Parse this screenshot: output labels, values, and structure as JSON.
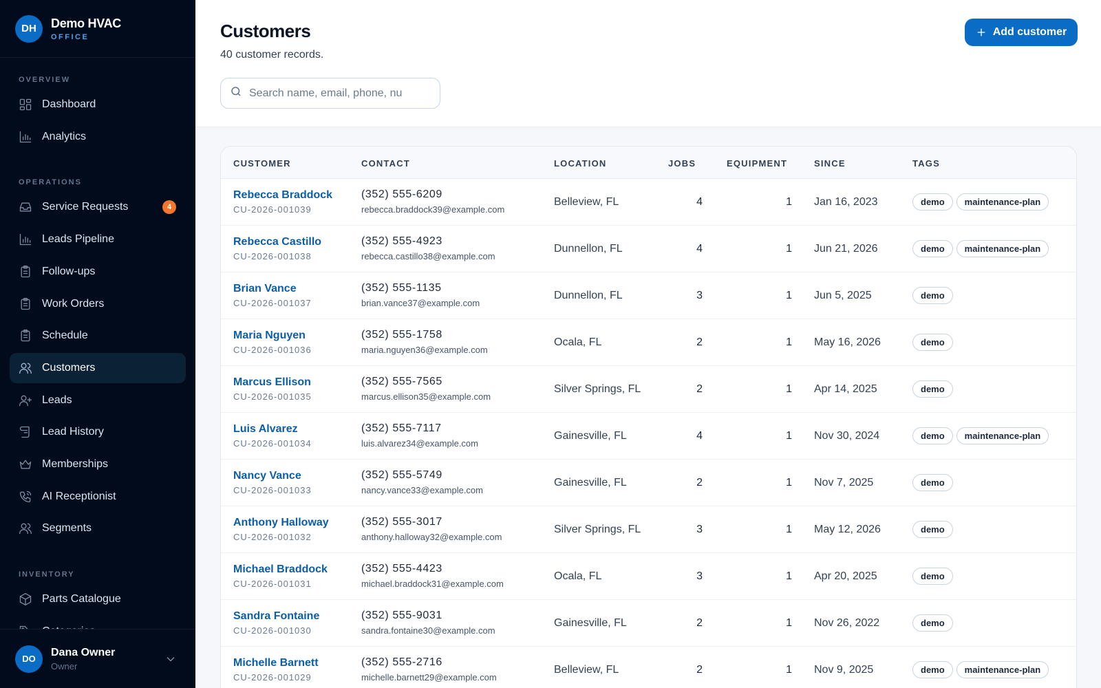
{
  "brand": {
    "initials": "DH",
    "name": "Demo HVAC",
    "sub": "OFFICE"
  },
  "sidebar": {
    "sections": [
      {
        "title": "OVERVIEW",
        "items": [
          {
            "label": "Dashboard",
            "icon": "dashboard-icon"
          },
          {
            "label": "Analytics",
            "icon": "analytics-icon"
          }
        ]
      },
      {
        "title": "OPERATIONS",
        "items": [
          {
            "label": "Service Requests",
            "icon": "inbox-icon",
            "badge": "4"
          },
          {
            "label": "Leads Pipeline",
            "icon": "analytics-icon"
          },
          {
            "label": "Follow-ups",
            "icon": "clipboard-icon"
          },
          {
            "label": "Work Orders",
            "icon": "clipboard-icon"
          },
          {
            "label": "Schedule",
            "icon": "clipboard-icon"
          },
          {
            "label": "Customers",
            "icon": "users-icon",
            "active": true
          },
          {
            "label": "Leads",
            "icon": "user-plus-icon"
          },
          {
            "label": "Lead History",
            "icon": "scroll-icon"
          },
          {
            "label": "Memberships",
            "icon": "crown-icon"
          },
          {
            "label": "AI Receptionist",
            "icon": "phone-icon"
          },
          {
            "label": "Segments",
            "icon": "users-icon"
          }
        ]
      },
      {
        "title": "INVENTORY",
        "items": [
          {
            "label": "Parts Catalogue",
            "icon": "package-icon"
          },
          {
            "label": "Categories",
            "icon": "tag-icon"
          }
        ]
      }
    ]
  },
  "user": {
    "initials": "DO",
    "name": "Dana Owner",
    "role": "Owner"
  },
  "header": {
    "title": "Customers",
    "subtitle": "40 customer records.",
    "search_placeholder": "Search name, email, phone, number",
    "add_label": "Add customer"
  },
  "table": {
    "columns": [
      "CUSTOMER",
      "CONTACT",
      "LOCATION",
      "JOBS",
      "EQUIPMENT",
      "SINCE",
      "TAGS"
    ],
    "rows": [
      {
        "name": "Rebecca Braddock",
        "id": "CU-2026-001039",
        "phone": "(352) 555-6209",
        "email": "rebecca.braddock39@example.com",
        "location": "Belleview, FL",
        "jobs": "4",
        "equipment": "1",
        "since": "Jan 16, 2023",
        "tags": [
          "demo",
          "maintenance-plan"
        ]
      },
      {
        "name": "Rebecca Castillo",
        "id": "CU-2026-001038",
        "phone": "(352) 555-4923",
        "email": "rebecca.castillo38@example.com",
        "location": "Dunnellon, FL",
        "jobs": "4",
        "equipment": "1",
        "since": "Jun 21, 2026",
        "tags": [
          "demo",
          "maintenance-plan"
        ]
      },
      {
        "name": "Brian Vance",
        "id": "CU-2026-001037",
        "phone": "(352) 555-1135",
        "email": "brian.vance37@example.com",
        "location": "Dunnellon, FL",
        "jobs": "3",
        "equipment": "1",
        "since": "Jun 5, 2025",
        "tags": [
          "demo"
        ]
      },
      {
        "name": "Maria Nguyen",
        "id": "CU-2026-001036",
        "phone": "(352) 555-1758",
        "email": "maria.nguyen36@example.com",
        "location": "Ocala, FL",
        "jobs": "2",
        "equipment": "1",
        "since": "May 16, 2026",
        "tags": [
          "demo"
        ]
      },
      {
        "name": "Marcus Ellison",
        "id": "CU-2026-001035",
        "phone": "(352) 555-7565",
        "email": "marcus.ellison35@example.com",
        "location": "Silver Springs, FL",
        "jobs": "2",
        "equipment": "1",
        "since": "Apr 14, 2025",
        "tags": [
          "demo"
        ]
      },
      {
        "name": "Luis Alvarez",
        "id": "CU-2026-001034",
        "phone": "(352) 555-7117",
        "email": "luis.alvarez34@example.com",
        "location": "Gainesville, FL",
        "jobs": "4",
        "equipment": "1",
        "since": "Nov 30, 2024",
        "tags": [
          "demo",
          "maintenance-plan"
        ]
      },
      {
        "name": "Nancy Vance",
        "id": "CU-2026-001033",
        "phone": "(352) 555-5749",
        "email": "nancy.vance33@example.com",
        "location": "Gainesville, FL",
        "jobs": "2",
        "equipment": "1",
        "since": "Nov 7, 2025",
        "tags": [
          "demo"
        ]
      },
      {
        "name": "Anthony Halloway",
        "id": "CU-2026-001032",
        "phone": "(352) 555-3017",
        "email": "anthony.halloway32@example.com",
        "location": "Silver Springs, FL",
        "jobs": "3",
        "equipment": "1",
        "since": "May 12, 2026",
        "tags": [
          "demo"
        ]
      },
      {
        "name": "Michael Braddock",
        "id": "CU-2026-001031",
        "phone": "(352) 555-4423",
        "email": "michael.braddock31@example.com",
        "location": "Ocala, FL",
        "jobs": "3",
        "equipment": "1",
        "since": "Apr 20, 2025",
        "tags": [
          "demo"
        ]
      },
      {
        "name": "Sandra Fontaine",
        "id": "CU-2026-001030",
        "phone": "(352) 555-9031",
        "email": "sandra.fontaine30@example.com",
        "location": "Gainesville, FL",
        "jobs": "2",
        "equipment": "1",
        "since": "Nov 26, 2022",
        "tags": [
          "demo"
        ]
      },
      {
        "name": "Michelle Barnett",
        "id": "CU-2026-001029",
        "phone": "(352) 555-2716",
        "email": "michelle.barnett29@example.com",
        "location": "Belleview, FL",
        "jobs": "2",
        "equipment": "1",
        "since": "Nov 9, 2025",
        "tags": [
          "demo",
          "maintenance-plan"
        ]
      }
    ]
  }
}
